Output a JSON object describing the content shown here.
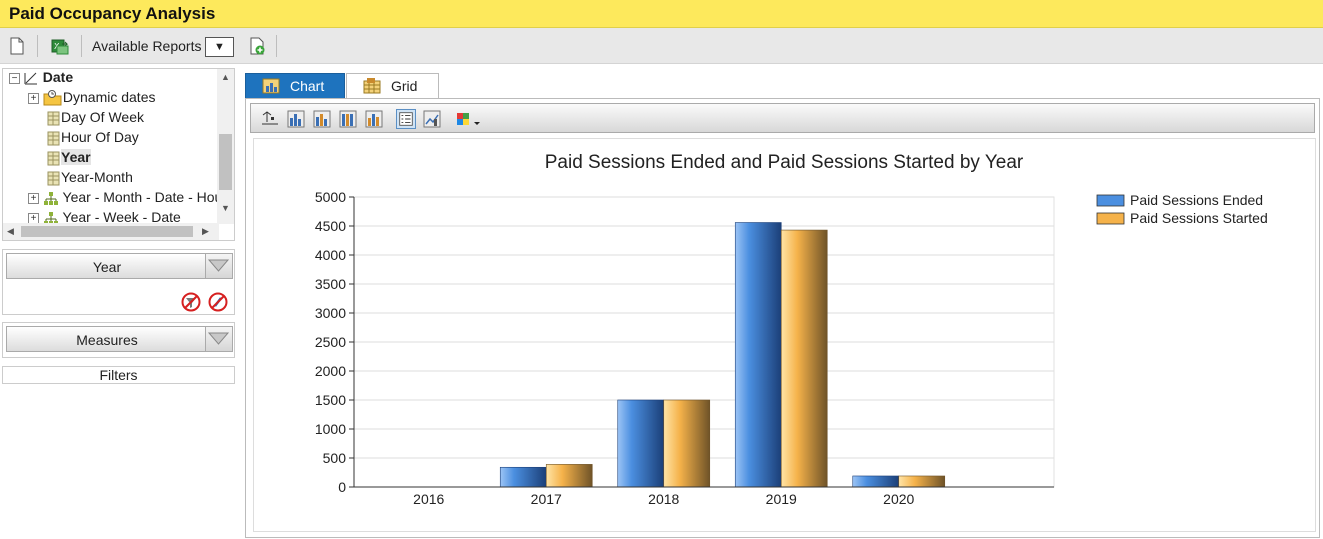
{
  "window": {
    "title": "Paid Occupancy Analysis"
  },
  "toolbar": {
    "available_reports_label": "Available Reports",
    "dropdown_arrow": "▼"
  },
  "tree": {
    "root_label": "Date",
    "items": [
      {
        "label": "Dynamic dates",
        "icon": "folder-clock-icon",
        "expandable": true
      },
      {
        "label": "Day Of Week",
        "icon": "level-icon",
        "expandable": false
      },
      {
        "label": "Hour Of Day",
        "icon": "level-icon",
        "expandable": false
      },
      {
        "label": "Year",
        "icon": "level-icon",
        "expandable": false,
        "selected": true
      },
      {
        "label": "Year-Month",
        "icon": "level-icon",
        "expandable": false
      },
      {
        "label": "Year - Month - Date - Hou",
        "icon": "hierarchy-icon",
        "expandable": true
      },
      {
        "label": "Year - Week - Date",
        "icon": "hierarchy-icon",
        "expandable": true
      }
    ]
  },
  "rows_box": {
    "label": "Year"
  },
  "measures_box": {
    "label": "Measures"
  },
  "filters": {
    "label": "Filters"
  },
  "tabs": [
    {
      "label": "Chart",
      "active": true
    },
    {
      "label": "Grid",
      "active": false
    }
  ],
  "colors": {
    "series1": "#4b8fe0",
    "series2": "#f5b24a",
    "title_bar": "#fde95c",
    "active_tab": "#1e73be"
  },
  "chart_data": {
    "type": "bar",
    "title": "Paid Sessions Ended and Paid Sessions Started by Year",
    "categories": [
      "2016",
      "2017",
      "2018",
      "2019",
      "2020"
    ],
    "series": [
      {
        "name": "Paid Sessions Ended",
        "values": [
          0,
          340,
          1500,
          4560,
          190
        ]
      },
      {
        "name": "Paid Sessions Started",
        "values": [
          0,
          390,
          1500,
          4430,
          190
        ]
      }
    ],
    "ylim": [
      0,
      5000
    ],
    "yticks": [
      0,
      500,
      1000,
      1500,
      2000,
      2500,
      3000,
      3500,
      4000,
      4500,
      5000
    ],
    "grid": true,
    "legend": "top-right"
  }
}
